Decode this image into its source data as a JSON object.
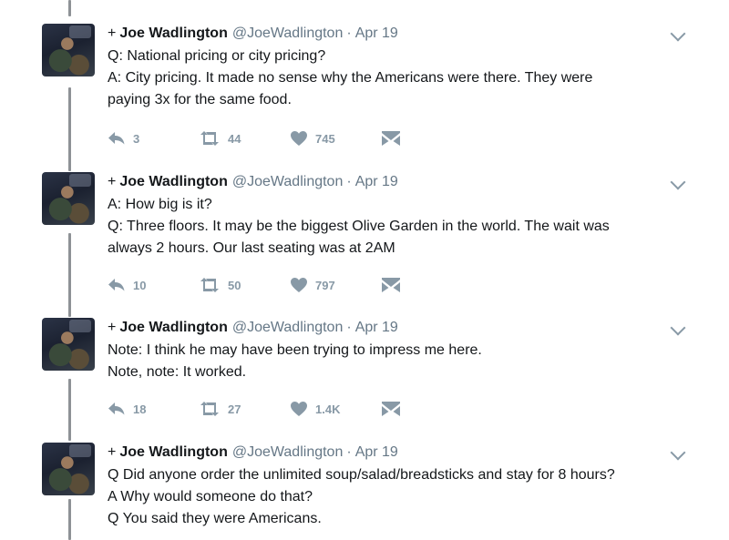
{
  "icons": {
    "reply": "reply-arrow-icon",
    "retweet": "retweet-icon",
    "like": "heart-icon",
    "message": "envelope-icon",
    "more": "chevron-down-icon"
  },
  "colors": {
    "name": "#14171a",
    "meta": "#657786",
    "action_icon": "#8899a6",
    "thread_line": "#8e9296"
  },
  "tweets": [
    {
      "plus": "+",
      "name": "Joe Wadlington",
      "handle": "@JoeWadlington",
      "separator": "·",
      "date": "Apr 19",
      "lines": [
        "Q: National pricing or city pricing?",
        "A: City pricing. It made no sense why the Americans were there. They were",
        "paying 3x for the same food."
      ],
      "replies": "3",
      "retweets": "44",
      "likes": "745"
    },
    {
      "plus": "+",
      "name": "Joe Wadlington",
      "handle": "@JoeWadlington",
      "separator": "·",
      "date": "Apr 19",
      "lines": [
        "A: How big is it?",
        "Q: Three floors. It may be the biggest Olive Garden in the world. The wait was",
        "always 2 hours. Our last seating was at 2AM"
      ],
      "replies": "10",
      "retweets": "50",
      "likes": "797"
    },
    {
      "plus": "+",
      "name": "Joe Wadlington",
      "handle": "@JoeWadlington",
      "separator": "·",
      "date": "Apr 19",
      "lines": [
        "Note: I think he may have been trying to impress me here.",
        "Note, note: It worked."
      ],
      "replies": "18",
      "retweets": "27",
      "likes": "1.4K"
    },
    {
      "plus": "+",
      "name": "Joe Wadlington",
      "handle": "@JoeWadlington",
      "separator": "·",
      "date": "Apr 19",
      "lines": [
        "Q Did anyone order the unlimited soup/salad/breadsticks and stay for 8 hours?",
        "A Why would someone do that?",
        "Q You said they were Americans."
      ]
    }
  ]
}
